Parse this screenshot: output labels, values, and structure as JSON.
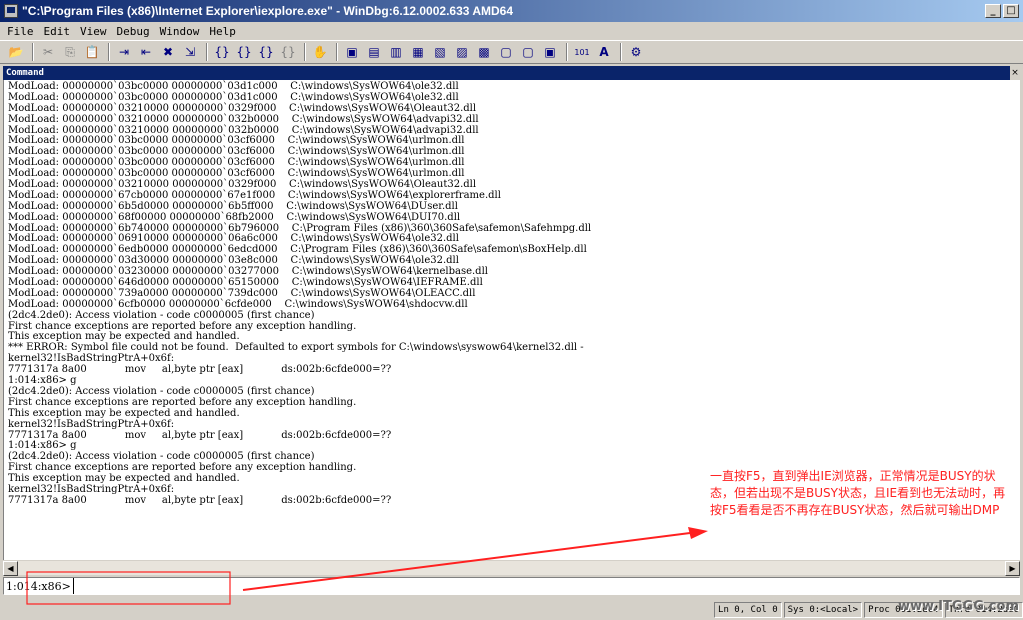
{
  "window": {
    "title": "\"C:\\Program Files (x86)\\Internet Explorer\\iexplore.exe\" - WinDbg:6.12.0002.633 AMD64",
    "app_icon": "windbg-icon",
    "minimize": "_",
    "restore": "□"
  },
  "menu": [
    "File",
    "Edit",
    "View",
    "Debug",
    "Window",
    "Help"
  ],
  "toolbar": {
    "glyphs": [
      "📂",
      "✂",
      "⎘",
      "📋",
      "⇥",
      "⇤",
      "✖",
      "⇲",
      "{}",
      "{}",
      "{}",
      "{}",
      "✋",
      "▣",
      "▤",
      "▥",
      "▦",
      "▧",
      "▨",
      "▩",
      "▢",
      "▢",
      "▣",
      "101",
      "A",
      "⚙"
    ]
  },
  "command_window": {
    "title": "Command",
    "close": "×"
  },
  "output_lines": [
    "ModLoad: 00000000`03bc0000 00000000`03d1c000    C:\\windows\\SysWOW64\\ole32.dll",
    "ModLoad: 00000000`03bc0000 00000000`03d1c000    C:\\windows\\SysWOW64\\ole32.dll",
    "ModLoad: 00000000`03210000 00000000`0329f000    C:\\windows\\SysWOW64\\Oleaut32.dll",
    "ModLoad: 00000000`03210000 00000000`032b0000    C:\\windows\\SysWOW64\\advapi32.dll",
    "ModLoad: 00000000`03210000 00000000`032b0000    C:\\windows\\SysWOW64\\advapi32.dll",
    "ModLoad: 00000000`03bc0000 00000000`03cf6000    C:\\windows\\SysWOW64\\urlmon.dll",
    "ModLoad: 00000000`03bc0000 00000000`03cf6000    C:\\windows\\SysWOW64\\urlmon.dll",
    "ModLoad: 00000000`03bc0000 00000000`03cf6000    C:\\windows\\SysWOW64\\urlmon.dll",
    "ModLoad: 00000000`03bc0000 00000000`03cf6000    C:\\windows\\SysWOW64\\urlmon.dll",
    "ModLoad: 00000000`03210000 00000000`0329f000    C:\\windows\\SysWOW64\\Oleaut32.dll",
    "ModLoad: 00000000`67cb0000 00000000`67e1f000    C:\\windows\\SysWOW64\\explorerframe.dll",
    "ModLoad: 00000000`6b5d0000 00000000`6b5ff000    C:\\windows\\SysWOW64\\DUser.dll",
    "ModLoad: 00000000`68f00000 00000000`68fb2000    C:\\windows\\SysWOW64\\DUI70.dll",
    "ModLoad: 00000000`6b740000 00000000`6b796000    C:\\Program Files (x86)\\360\\360Safe\\safemon\\Safehmpg.dll",
    "ModLoad: 00000000`06910000 00000000`06a6c000    C:\\windows\\SysWOW64\\ole32.dll",
    "ModLoad: 00000000`6edb0000 00000000`6edcd000    C:\\Program Files (x86)\\360\\360Safe\\safemon\\sBoxHelp.dll",
    "ModLoad: 00000000`03d30000 00000000`03e8c000    C:\\windows\\SysWOW64\\ole32.dll",
    "ModLoad: 00000000`03230000 00000000`03277000    C:\\windows\\SysWOW64\\kernelbase.dll",
    "ModLoad: 00000000`646d0000 00000000`65150000    C:\\windows\\SysWOW64\\IEFRAME.dll",
    "ModLoad: 00000000`739a0000 00000000`739dc000    C:\\windows\\SysWOW64\\OLEACC.dll",
    "ModLoad: 00000000`6cfb0000 00000000`6cfde000    C:\\windows\\SysWOW64\\shdocvw.dll",
    "(2dc4.2de0): Access violation - code c0000005 (first chance)",
    "First chance exceptions are reported before any exception handling.",
    "This exception may be expected and handled.",
    "*** ERROR: Symbol file could not be found.  Defaulted to export symbols for C:\\windows\\syswow64\\kernel32.dll -",
    "kernel32!IsBadStringPtrA+0x6f:",
    "7771317a 8a00            mov     al,byte ptr [eax]            ds:002b:6cfde000=??",
    "1:014:x86> g",
    "(2dc4.2de0): Access violation - code c0000005 (first chance)",
    "First chance exceptions are reported before any exception handling.",
    "This exception may be expected and handled.",
    "kernel32!IsBadStringPtrA+0x6f:",
    "7771317a 8a00            mov     al,byte ptr [eax]            ds:002b:6cfde000=??",
    "1:014:x86> g",
    "(2dc4.2de0): Access violation - code c0000005 (first chance)",
    "First chance exceptions are reported before any exception handling.",
    "This exception may be expected and handled.",
    "kernel32!IsBadStringPtrA+0x6f:",
    "7771317a 8a00            mov     al,byte ptr [eax]            ds:002b:6cfde000=??"
  ],
  "command_input": {
    "prompt": "1:014:x86>",
    "value": ""
  },
  "status": [
    "Ln 0, Col 0",
    "Sys 0:<Local>",
    "Proc 001:2dc4",
    "Thrd 014:2de0"
  ],
  "annotation": {
    "text": "一直按F5，直到弹出IE浏览器，正常情况是BUSY的状态，但若出现不是BUSY状态，且IE看到也无法动时，再按F5看看是否不再存在BUSY状态，然后就可输出DMP",
    "color": "#ff2020"
  },
  "watermark": "www.ITGGG.com",
  "colors": {
    "title_start": "#0a246a",
    "title_end": "#a6caf0",
    "annotation": "#ff2020"
  }
}
